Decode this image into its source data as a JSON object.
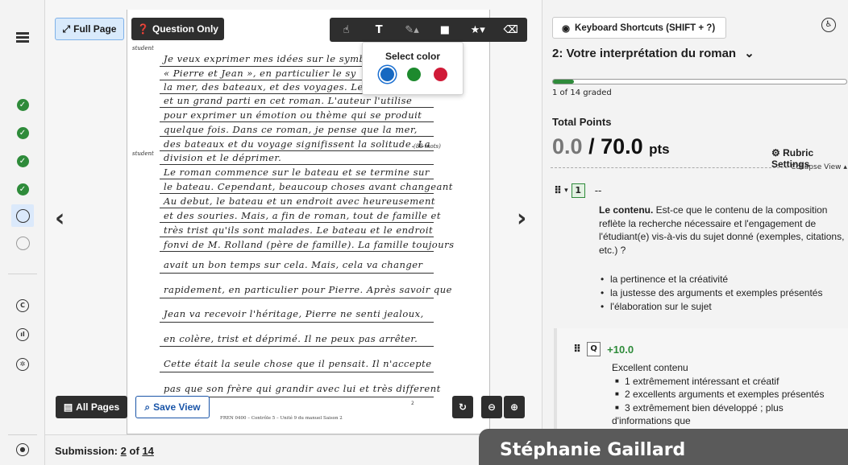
{
  "viewer": {
    "full_page_label": "Full Page",
    "question_only_label": "Question Only",
    "all_pages_label": "All Pages",
    "save_view_label": "Save View",
    "color_popup": {
      "title": "Select color",
      "colors": [
        "#1668c1",
        "#1d8a2e",
        "#d01a37"
      ],
      "selected": "#1668c1"
    },
    "page": {
      "margin_note_1": "student",
      "margin_note_2": "student",
      "margin_note_3": "(88 mots)",
      "footer": "FREN 0400 – Contrôle 5 – Unité 9 du manuel Saison 2",
      "page_number": "2",
      "handwriting": [
        "Je veux exprimer mes idées sur le symbo",
        "« Pierre et Jean », en particulier le sy",
        "la mer, des bateaux, et des voyages. Le",
        "et un grand parti en cet roman. L'auteur l'utilise",
        "pour exprimer un émotion ou thème qui se produit",
        "quelque fois. Dans ce roman, je pense que la mer,",
        "des bateaux et du voyage signifissent la solitude. La",
        "division et le déprimer.",
        "Le roman commence sur le bateau et se termine sur",
        "le bateau. Cependant, beaucoup choses avant changeant",
        "Au debut, le bateau et un endroit avec heureusement",
        "et des souries. Mais, a fin de roman, tout de famille et",
        "très trist qu'ils sont malades. Le bateau et le endroit",
        "fonvi de M. Rolland (père de famille). La famille toujours",
        "avait un bon temps sur cela. Mais, cela va changer",
        "rapidement, en particulier pour Pierre. Après savoir que",
        "Jean va recevoir l'héritage, Pierre ne senti jealoux,",
        "en colère, trist et déprimé. Il ne peux pas arrêter.",
        "Cette était la seule chose que il pensait. Il n'accepte",
        "pas que son frère qui grandir avec lui et très different"
      ]
    }
  },
  "bottom": {
    "submission_prefix": "Submission:",
    "submission_current": "2",
    "submission_of": "of",
    "submission_total": "14"
  },
  "panel": {
    "keyboard_shortcuts_label": "Keyboard Shortcuts (SHIFT + ?)",
    "question_title": "2: Votre interprétation du roman",
    "graded_text": "1 of 14 graded",
    "graded_fraction": 0.071,
    "total_points_label": "Total Points",
    "score": "0.0",
    "max_points": "/ 70.0",
    "pts_unit": "pts",
    "rubric_settings_label": "Rubric Settings",
    "collapse_view_label": "Collapse View",
    "rubric_number": "1",
    "rubric_dash": "--",
    "rubric_bold": "Le contenu.",
    "rubric_desc": " Est-ce que le contenu de la composition reflète la recherche nécessaire et l'engagement de l'étudiant(e) vis-à-vis du sujet donné (exemples, citations, etc.) ?",
    "rubric_bullets": [
      "la pertinence et la créativité",
      "la justesse des arguments et exemples présentés",
      "l'élaboration sur le sujet"
    ],
    "item_key": "Q",
    "item_points": "+10.0",
    "item_title": "Excellent contenu",
    "item_points_list": [
      "1 extrêmement intéressant et créatif",
      "2 excellents arguments et exemples présentés",
      "3 extrêmement bien développé ; plus"
    ],
    "item_trailing": "d'informations que"
  },
  "overlay_name": "Stéphanie Gaillard"
}
